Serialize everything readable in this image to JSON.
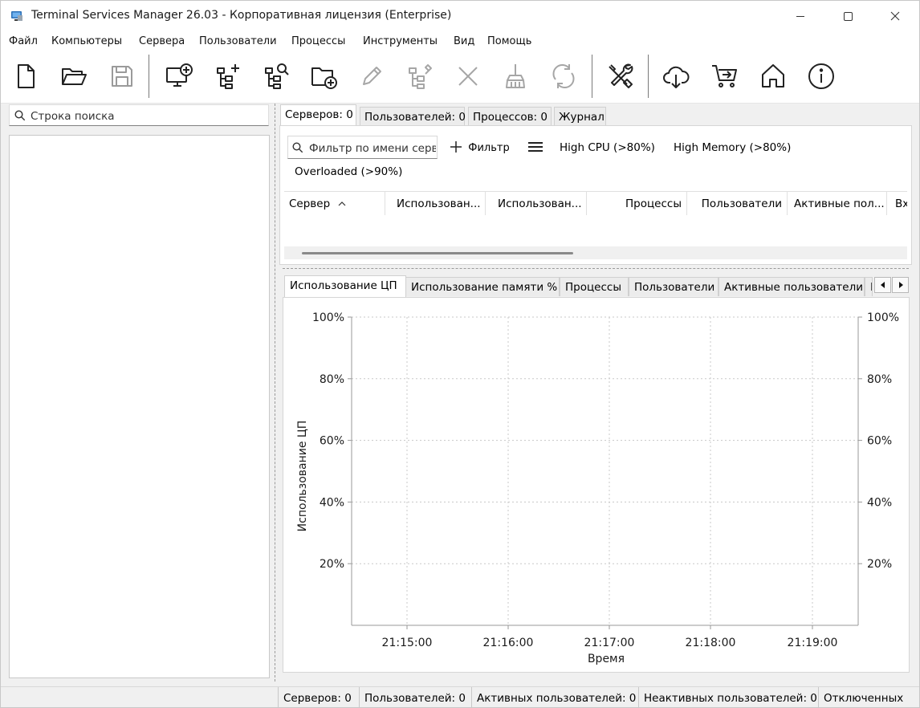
{
  "window": {
    "title": "Terminal Services Manager 26.03 - Корпоративная лицензия (Enterprise)"
  },
  "menu": {
    "items": [
      "Файл",
      "Компьютеры",
      "Сервера",
      "Пользователи",
      "Процессы",
      "Инструменты",
      "Вид",
      "Помощь"
    ]
  },
  "toolbar": {
    "icons": [
      "new-file-icon",
      "open-folder-icon",
      "save-icon",
      "add-computer-icon",
      "add-tree-node-icon",
      "find-tree-icon",
      "add-folder-icon",
      "edit-icon",
      "tree-tools-icon",
      "delete-icon",
      "broom-icon",
      "refresh-icon",
      "tools-icon",
      "cloud-download-icon",
      "cart-icon",
      "home-icon",
      "info-icon"
    ]
  },
  "left": {
    "search_placeholder": "Строка поиска"
  },
  "top_tabs": [
    "Серверов: 0",
    "Пользователей: 0",
    "Процессов: 0",
    "Журнал"
  ],
  "filter": {
    "placeholder": "Фильтр по имени серв",
    "add_filter_label": "Фильтр",
    "chips": [
      "High CPU (>80%)",
      "High Memory (>80%)",
      "Overloaded (>90%)"
    ]
  },
  "grid": {
    "columns": [
      "Сервер",
      "Использован...",
      "Использован...",
      "Процессы",
      "Пользователи",
      "Активные пол...",
      "Вх"
    ]
  },
  "bottom_tabs": [
    "Использование ЦП",
    "Использование памяти %",
    "Процессы",
    "Пользователи",
    "Активные пользователи",
    "Н"
  ],
  "chart_data": {
    "type": "line",
    "title": "",
    "xlabel": "Время",
    "ylabel": "Использование ЦП",
    "x_ticks": [
      "21:15:00",
      "21:16:00",
      "21:17:00",
      "21:18:00",
      "21:19:00"
    ],
    "y_ticks": [
      "20%",
      "40%",
      "60%",
      "80%",
      "100%"
    ],
    "y2_ticks": [
      "20%",
      "40%",
      "60%",
      "80%",
      "100%"
    ],
    "ylim": [
      0,
      100
    ],
    "grid": true,
    "series": []
  },
  "status": [
    "Серверов: 0",
    "Пользователей: 0",
    "Активных пользователей: 0",
    "Неактивных пользователей: 0",
    "Отключенных"
  ]
}
